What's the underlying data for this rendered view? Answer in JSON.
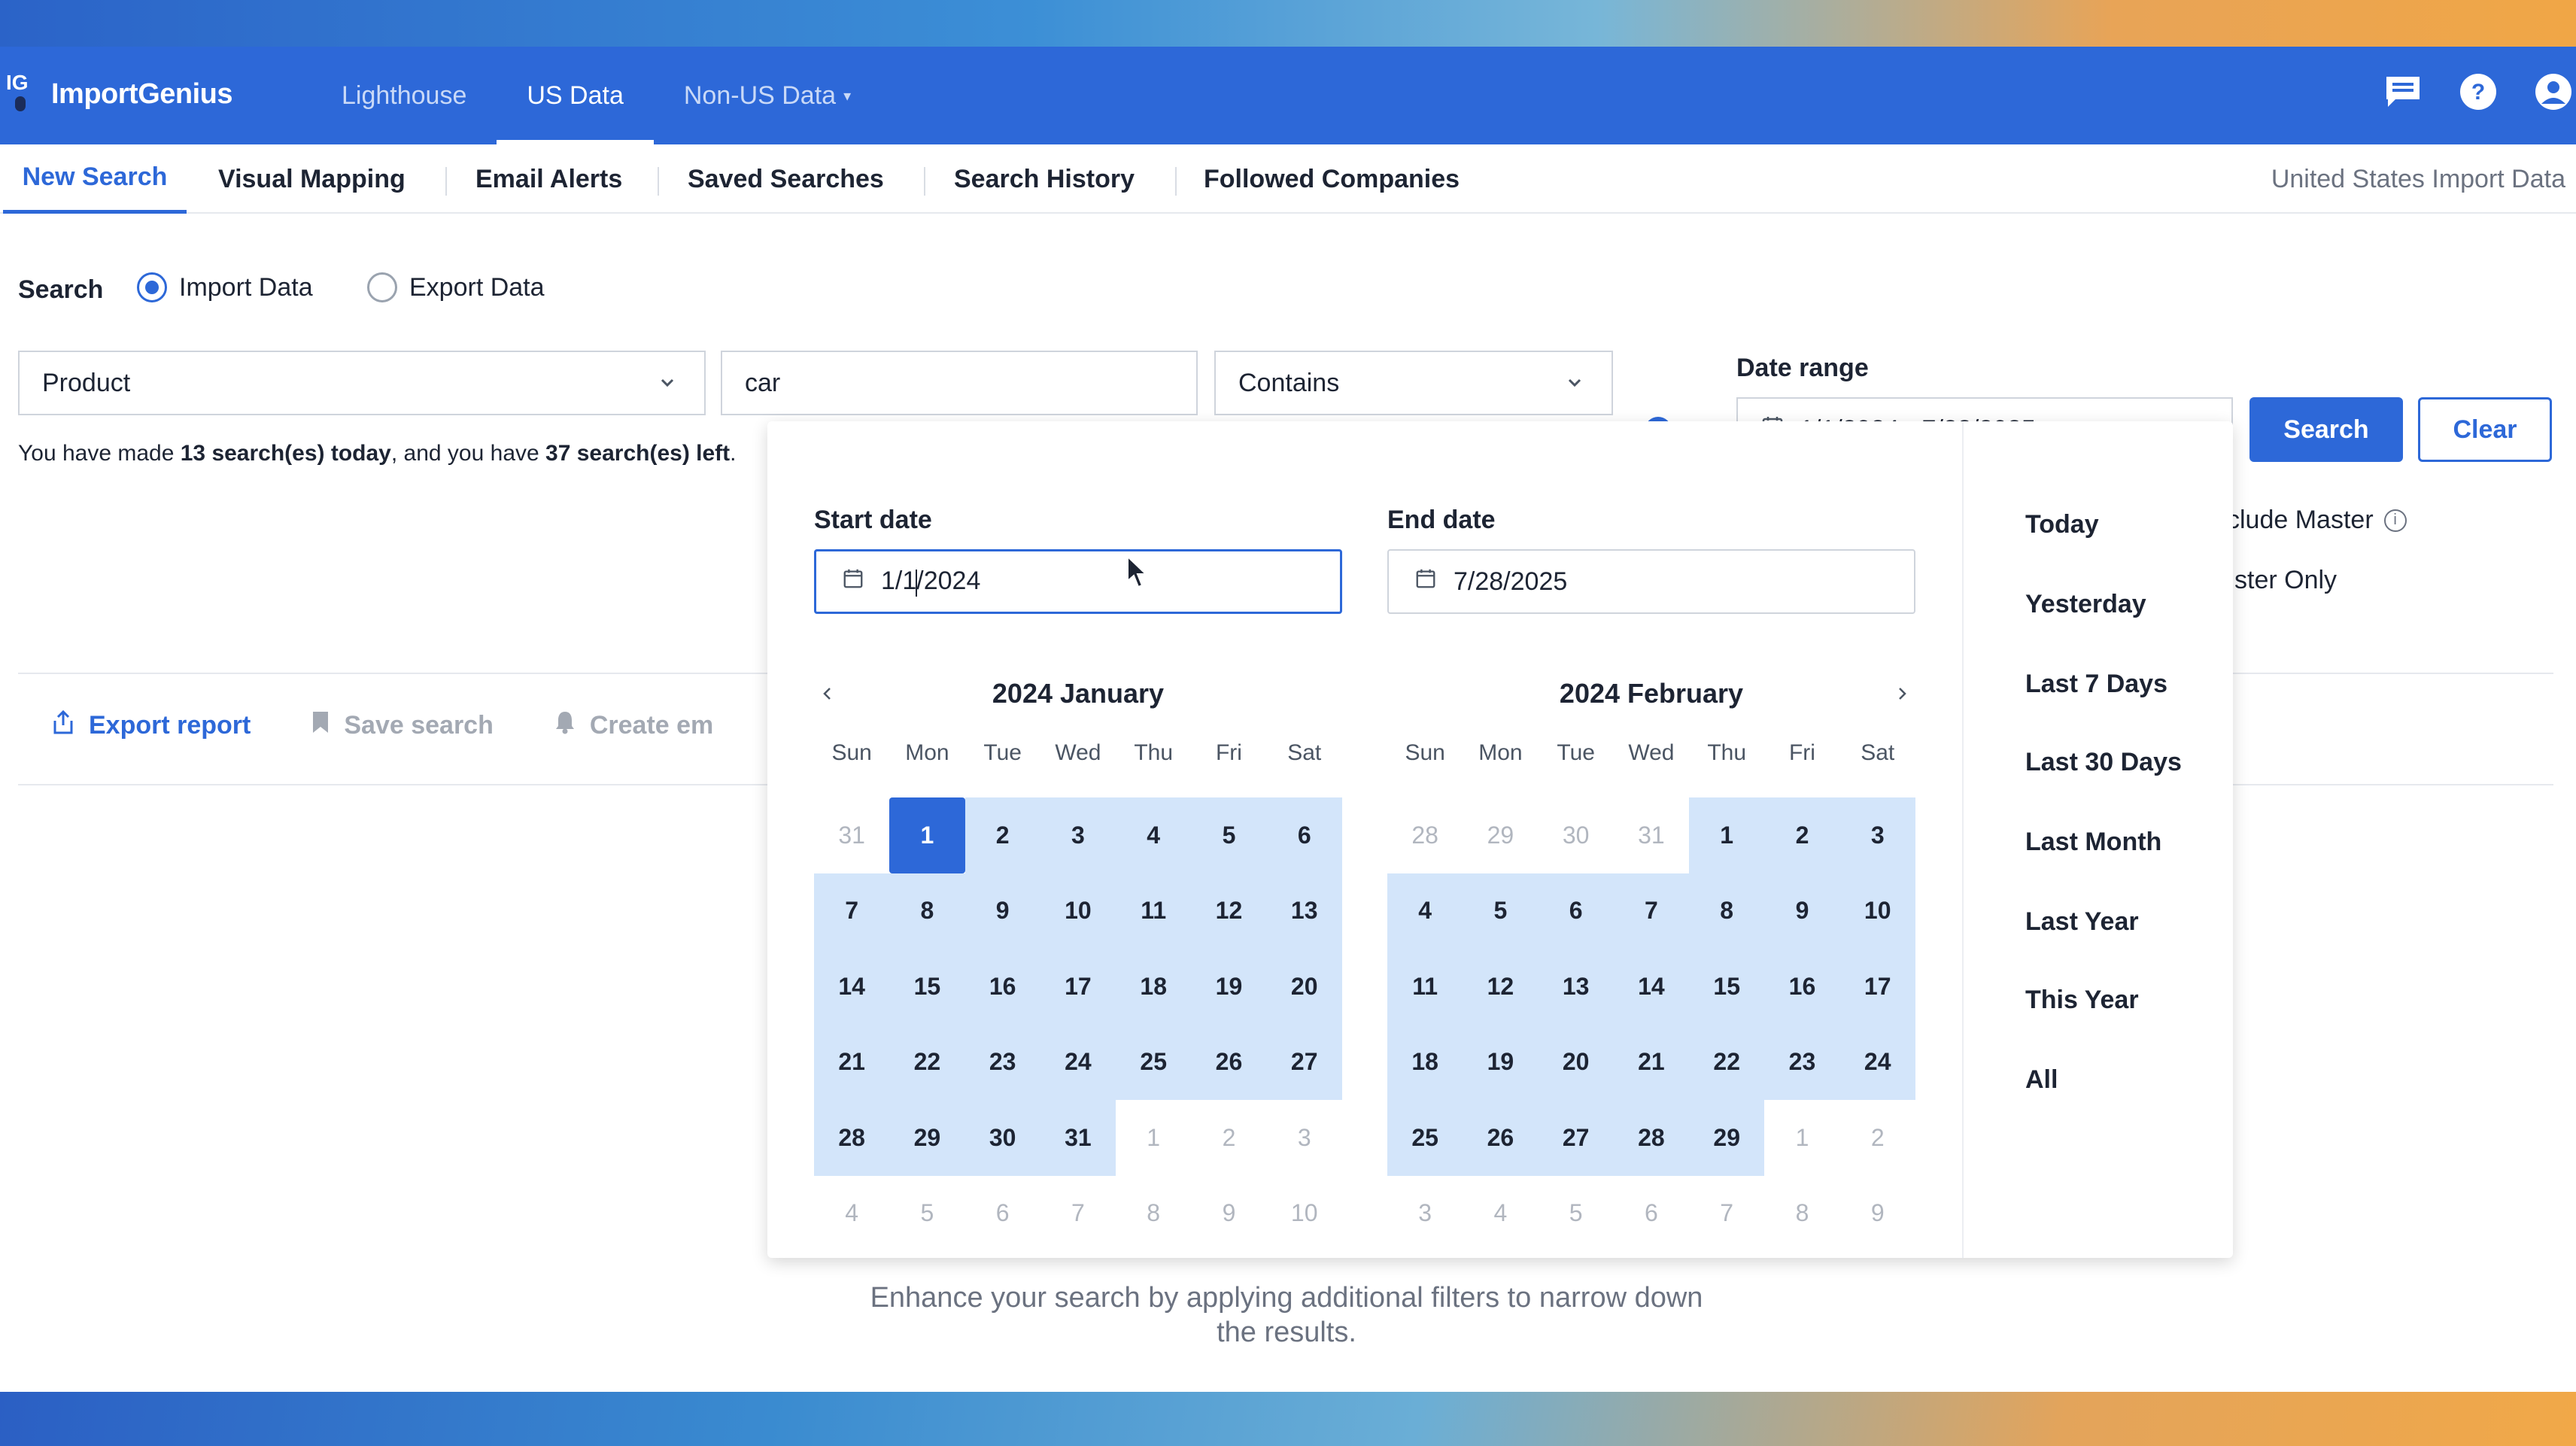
{
  "brand": {
    "logo_mark": "IG",
    "name": "ImportGenius"
  },
  "topnav": [
    {
      "label": "Lighthouse",
      "active": false
    },
    {
      "label": "US Data",
      "active": true
    },
    {
      "label": "Non-US Data",
      "active": false,
      "dropdown": true
    }
  ],
  "top_icons": [
    "chat-icon",
    "help-icon",
    "account-icon"
  ],
  "subnav": {
    "items": [
      "New Search",
      "Visual Mapping",
      "Email Alerts",
      "Saved Searches",
      "Search History",
      "Followed Companies"
    ],
    "active": "New Search",
    "right_label": "United States Import Data"
  },
  "search": {
    "label": "Search",
    "radios": [
      {
        "label": "Import Data",
        "checked": true
      },
      {
        "label": "Export Data",
        "checked": false
      }
    ],
    "field_select": "Product",
    "query_value": "car",
    "operator_select": "Contains",
    "date_range_label": "Date range",
    "date_range_value": "1/1/2024 - 7/28/2025",
    "search_button": "Search",
    "clear_button": "Clear"
  },
  "quota": {
    "prefix": "You have made ",
    "made": "13 search(es) today",
    "middle": ", and you have ",
    "left": "37 search(es) left",
    "suffix": "."
  },
  "options_right": {
    "include_master": "clude Master",
    "master_only": "ster Only"
  },
  "actions": {
    "export_report": "Export report",
    "save_search": "Save search",
    "create_alert": "Create em"
  },
  "hint": {
    "line1": "Enhance your search by applying additional filters to narrow down",
    "line2": "the results."
  },
  "picker": {
    "start_label": "Start date",
    "start_value_before_cursor": "1/1",
    "start_value_after_cursor": "/2024",
    "end_label": "End date",
    "end_value": "7/28/2025",
    "weekdays": [
      "Sun",
      "Mon",
      "Tue",
      "Wed",
      "Thu",
      "Fri",
      "Sat"
    ],
    "months": [
      {
        "title": "2024 January",
        "days": [
          {
            "d": "31",
            "out": true
          },
          {
            "d": "1",
            "sel": true
          },
          {
            "d": "2",
            "range": true
          },
          {
            "d": "3",
            "range": true
          },
          {
            "d": "4",
            "range": true
          },
          {
            "d": "5",
            "range": true
          },
          {
            "d": "6",
            "range": true
          },
          {
            "d": "7",
            "range": true
          },
          {
            "d": "8",
            "range": true
          },
          {
            "d": "9",
            "range": true
          },
          {
            "d": "10",
            "range": true
          },
          {
            "d": "11",
            "range": true
          },
          {
            "d": "12",
            "range": true
          },
          {
            "d": "13",
            "range": true
          },
          {
            "d": "14",
            "range": true
          },
          {
            "d": "15",
            "range": true
          },
          {
            "d": "16",
            "range": true
          },
          {
            "d": "17",
            "range": true
          },
          {
            "d": "18",
            "range": true
          },
          {
            "d": "19",
            "range": true
          },
          {
            "d": "20",
            "range": true
          },
          {
            "d": "21",
            "range": true
          },
          {
            "d": "22",
            "range": true
          },
          {
            "d": "23",
            "range": true
          },
          {
            "d": "24",
            "range": true
          },
          {
            "d": "25",
            "range": true
          },
          {
            "d": "26",
            "range": true
          },
          {
            "d": "27",
            "range": true
          },
          {
            "d": "28",
            "range": true
          },
          {
            "d": "29",
            "range": true
          },
          {
            "d": "30",
            "range": true
          },
          {
            "d": "31",
            "range": true
          },
          {
            "d": "1",
            "out": true
          },
          {
            "d": "2",
            "out": true
          },
          {
            "d": "3",
            "out": true
          },
          {
            "d": "4",
            "out": true
          },
          {
            "d": "5",
            "out": true
          },
          {
            "d": "6",
            "out": true
          },
          {
            "d": "7",
            "out": true
          },
          {
            "d": "8",
            "out": true
          },
          {
            "d": "9",
            "out": true
          },
          {
            "d": "10",
            "out": true
          }
        ]
      },
      {
        "title": "2024 February",
        "days": [
          {
            "d": "28",
            "out": true
          },
          {
            "d": "29",
            "out": true
          },
          {
            "d": "30",
            "out": true
          },
          {
            "d": "31",
            "out": true
          },
          {
            "d": "1",
            "range": true
          },
          {
            "d": "2",
            "range": true
          },
          {
            "d": "3",
            "range": true
          },
          {
            "d": "4",
            "range": true
          },
          {
            "d": "5",
            "range": true
          },
          {
            "d": "6",
            "range": true
          },
          {
            "d": "7",
            "range": true
          },
          {
            "d": "8",
            "range": true
          },
          {
            "d": "9",
            "range": true
          },
          {
            "d": "10",
            "range": true
          },
          {
            "d": "11",
            "range": true
          },
          {
            "d": "12",
            "range": true
          },
          {
            "d": "13",
            "range": true
          },
          {
            "d": "14",
            "range": true
          },
          {
            "d": "15",
            "range": true
          },
          {
            "d": "16",
            "range": true
          },
          {
            "d": "17",
            "range": true
          },
          {
            "d": "18",
            "range": true
          },
          {
            "d": "19",
            "range": true
          },
          {
            "d": "20",
            "range": true
          },
          {
            "d": "21",
            "range": true
          },
          {
            "d": "22",
            "range": true
          },
          {
            "d": "23",
            "range": true
          },
          {
            "d": "24",
            "range": true
          },
          {
            "d": "25",
            "range": true
          },
          {
            "d": "26",
            "range": true
          },
          {
            "d": "27",
            "range": true
          },
          {
            "d": "28",
            "range": true
          },
          {
            "d": "29",
            "range": true
          },
          {
            "d": "1",
            "out": true
          },
          {
            "d": "2",
            "out": true
          },
          {
            "d": "3",
            "out": true
          },
          {
            "d": "4",
            "out": true
          },
          {
            "d": "5",
            "out": true
          },
          {
            "d": "6",
            "out": true
          },
          {
            "d": "7",
            "out": true
          },
          {
            "d": "8",
            "out": true
          },
          {
            "d": "9",
            "out": true
          }
        ]
      }
    ],
    "presets": [
      "Today",
      "Yesterday",
      "Last 7 Days",
      "Last 30 Days",
      "Last Month",
      "Last Year",
      "This Year",
      "All"
    ]
  },
  "colors": {
    "primary": "#2d68d8",
    "range": "#d3e5fa",
    "text": "#1d2433",
    "muted": "#b1b6bf"
  }
}
